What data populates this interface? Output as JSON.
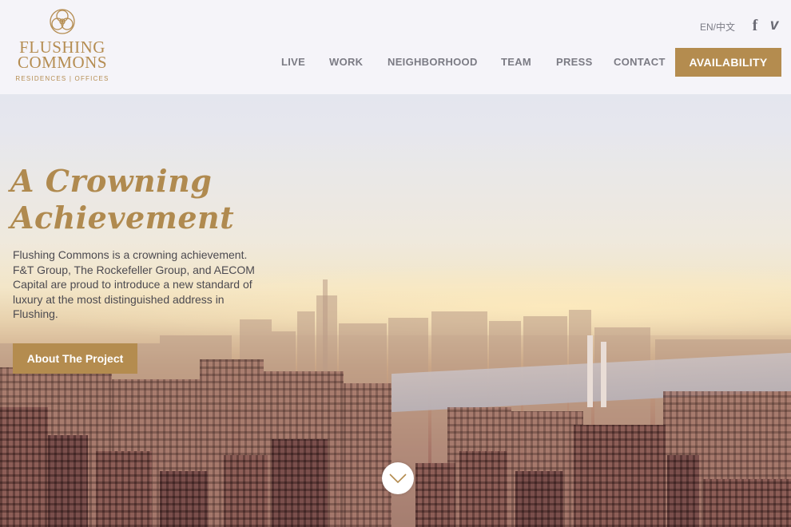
{
  "brand": {
    "name": "FLUSHING COMMONS",
    "name_line1": "FLUSHING",
    "name_line2": "COMMONS",
    "tagline": "RESIDENCES | OFFICES",
    "color": "#b48c4f"
  },
  "header": {
    "language": "EN/中文",
    "social": [
      {
        "icon": "facebook-icon",
        "glyph": "f"
      },
      {
        "icon": "vimeo-icon",
        "glyph": "v"
      }
    ],
    "nav": [
      "LIVE",
      "WORK",
      "NEIGHBORHOOD",
      "TEAM",
      "PRESS",
      "CONTACT"
    ],
    "cta": "AVAILABILITY"
  },
  "hero": {
    "headline_line1": "A Crowning",
    "headline_line2": "Achievement",
    "intro": "Flushing Commons is a crowning achievement. F&T Group, The Rockefeller Group, and AECOM Capital are proud to introduce a new standard of luxury at the most distinguished address in Flushing.",
    "button": "About The Project",
    "scroll_icon": "chevron-down-icon",
    "background": "city-skyline-photo"
  }
}
